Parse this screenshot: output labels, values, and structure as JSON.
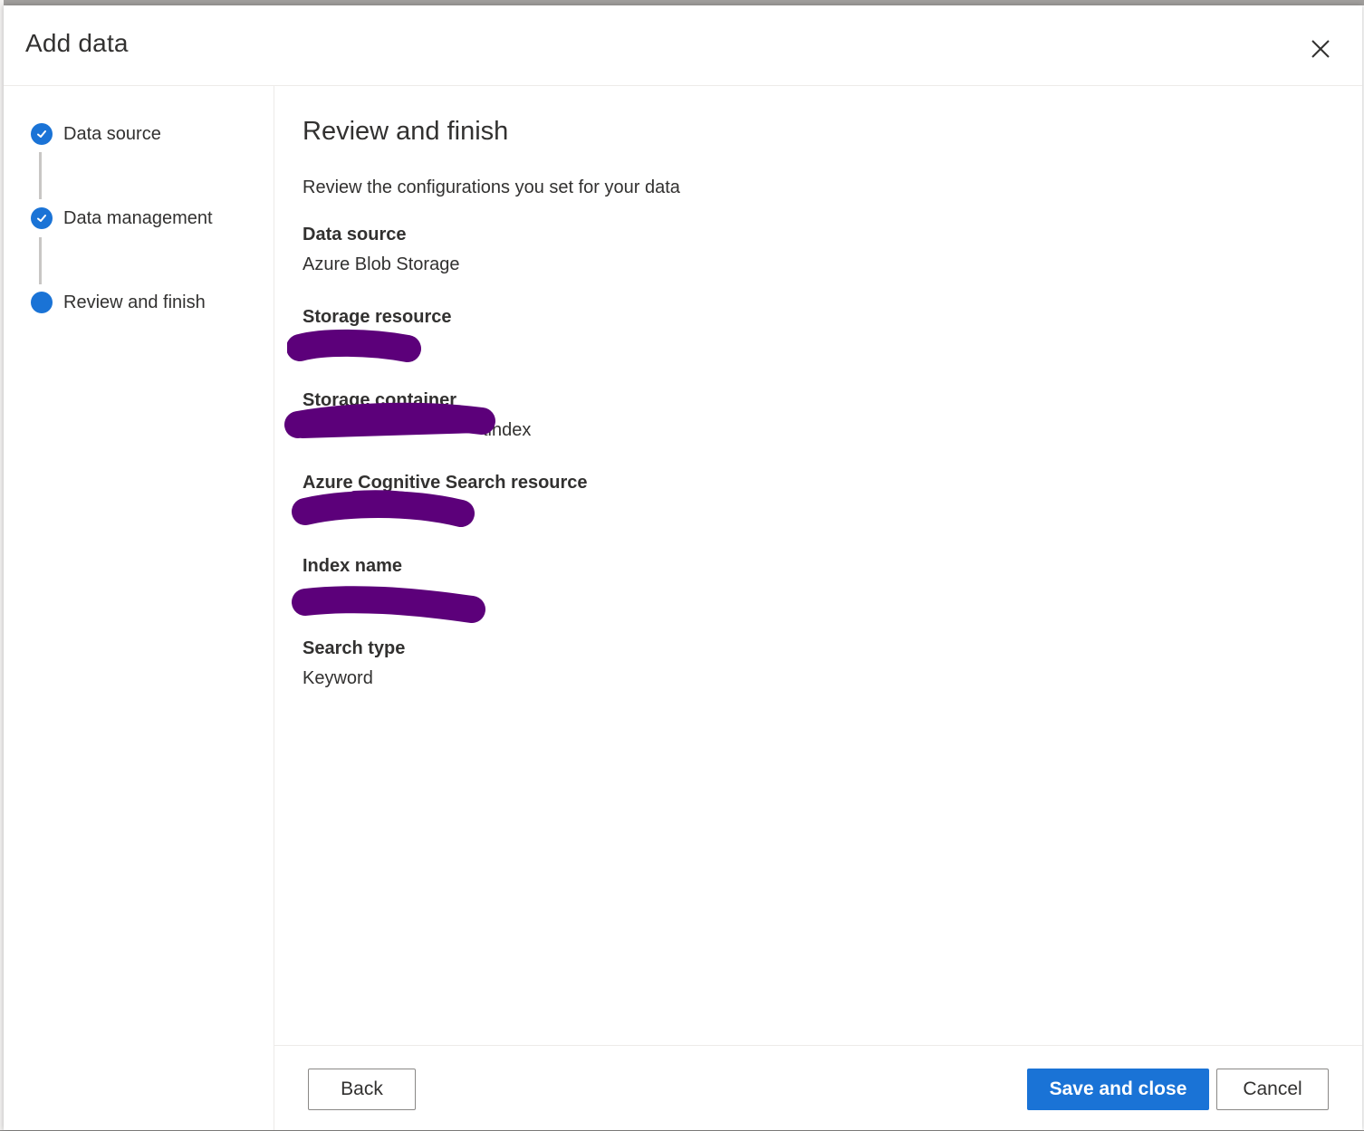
{
  "dialog": {
    "title": "Add data",
    "close_icon": "close-icon"
  },
  "stepper": {
    "steps": [
      {
        "label": "Data source",
        "state": "completed",
        "icon": "checkmark-icon"
      },
      {
        "label": "Data management",
        "state": "completed",
        "icon": "checkmark-icon"
      },
      {
        "label": "Review and finish",
        "state": "current",
        "icon": "dot-icon"
      }
    ]
  },
  "content": {
    "title": "Review and finish",
    "description": "Review the configurations you set for your data",
    "fields": [
      {
        "label": "Data source",
        "value": "Azure Blob Storage",
        "redacted": false
      },
      {
        "label": "Storage resource",
        "value": "ata",
        "redacted": true
      },
      {
        "label": "Storage container",
        "value": "tindex",
        "redacted": true
      },
      {
        "label": "Azure Cognitive Search resource",
        "value": "",
        "redacted": true
      },
      {
        "label": "Index name",
        "value": "",
        "redacted": true
      },
      {
        "label": "Search type",
        "value": "Keyword",
        "redacted": false
      }
    ]
  },
  "footer": {
    "back_label": "Back",
    "save_label": "Save and close",
    "cancel_label": "Cancel"
  },
  "colors": {
    "accent": "#1a73d6",
    "redaction": "#5c007a"
  }
}
